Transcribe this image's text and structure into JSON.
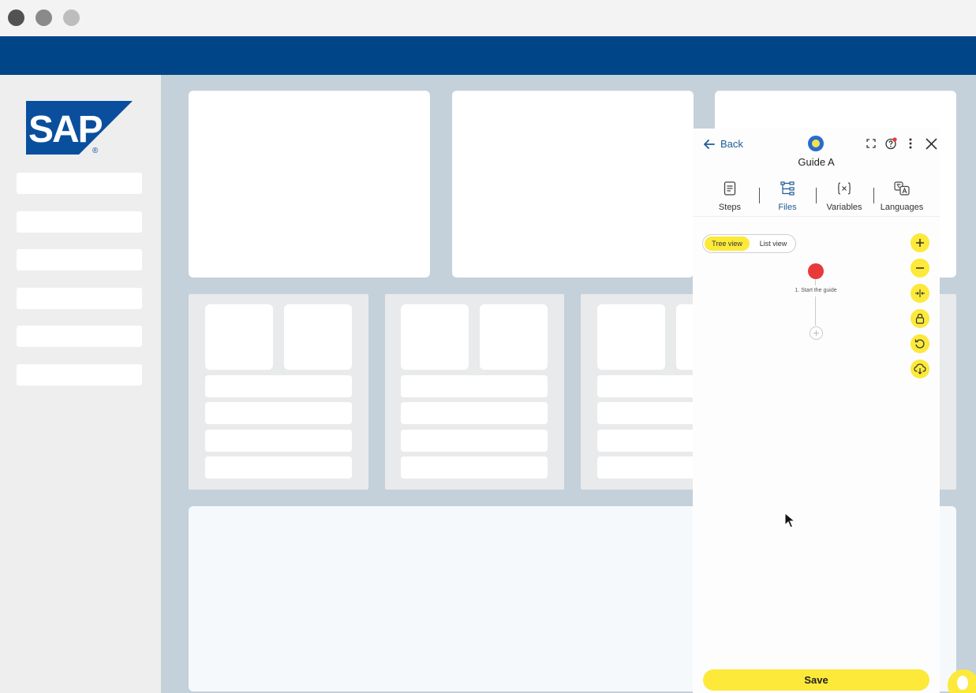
{
  "brand": {
    "logo_text": "SAP",
    "logo_color": "#0a4f9e"
  },
  "colors": {
    "appbar": "#004587",
    "accent_yellow": "#fce93a",
    "start_node": "#e83a3a",
    "link_blue": "#1f5b96"
  },
  "guide_panel": {
    "back_label": "Back",
    "title": "Guide A",
    "header_icons": [
      "fullscreen-icon",
      "help-icon",
      "more-icon",
      "close-icon"
    ],
    "tabs": [
      {
        "label": "Steps",
        "icon": "document-icon",
        "active": false
      },
      {
        "label": "Files",
        "icon": "tree-icon",
        "active": true
      },
      {
        "label": "Variables",
        "icon": "braces-icon",
        "active": false
      },
      {
        "label": "Languages",
        "icon": "translate-icon",
        "active": false
      }
    ],
    "view_toggle": {
      "options": [
        "Tree view",
        "List view"
      ],
      "selected": "Tree view"
    },
    "tree": {
      "nodes": [
        {
          "label": "1. Start the guide"
        }
      ]
    },
    "tree_controls": [
      "zoom-in-icon",
      "zoom-out-icon",
      "fit-icon",
      "lock-icon",
      "reset-icon",
      "cloud-download-icon"
    ],
    "save_label": "Save"
  }
}
